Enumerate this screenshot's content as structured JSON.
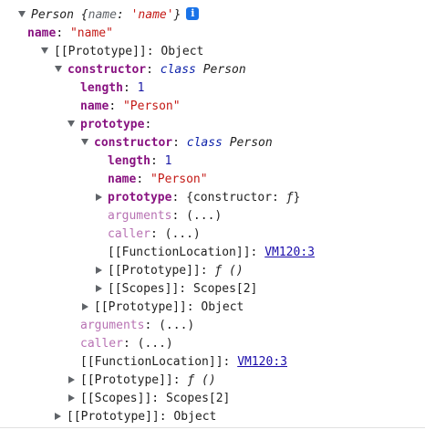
{
  "root": {
    "class_name": "Person",
    "preview_open": " {",
    "preview_key": "name",
    "preview_colon": ": ",
    "preview_value": "'name'",
    "preview_close": "}",
    "info_icon_glyph": "i"
  },
  "rows": {
    "r1": {
      "key": "name",
      "value": "\"name\""
    },
    "r2": {
      "key": "[[Prototype]]",
      "value": "Object"
    },
    "r3": {
      "key": "constructor",
      "kw": "class",
      "value": "Person"
    },
    "r4": {
      "key": "length",
      "value": "1"
    },
    "r5": {
      "key": "name",
      "value": "\"Person\""
    },
    "r6": {
      "key": "prototype",
      "value": ""
    },
    "r7": {
      "key": "constructor",
      "kw": "class",
      "value": "Person"
    },
    "r8": {
      "key": "length",
      "value": "1"
    },
    "r9": {
      "key": "name",
      "value": "\"Person\""
    },
    "r10": {
      "key": "prototype",
      "value": "{constructor: ",
      "fn": "ƒ",
      "close": "}"
    },
    "r11": {
      "key": "arguments",
      "value": "(...)"
    },
    "r12": {
      "key": "caller",
      "value": "(...)"
    },
    "r13": {
      "key": "[[FunctionLocation]]",
      "value": "VM120:3"
    },
    "r14": {
      "key": "[[Prototype]]",
      "value": "ƒ ()"
    },
    "r15": {
      "key": "[[Scopes]]",
      "value": "Scopes[2]"
    },
    "r16": {
      "key": "[[Prototype]]",
      "value": "Object"
    },
    "r17": {
      "key": "arguments",
      "value": "(...)"
    },
    "r18": {
      "key": "caller",
      "value": "(...)"
    },
    "r19": {
      "key": "[[FunctionLocation]]",
      "value": "VM120:3"
    },
    "r20": {
      "key": "[[Prototype]]",
      "value": "ƒ ()"
    },
    "r21": {
      "key": "[[Scopes]]",
      "value": "Scopes[2]"
    },
    "r22": {
      "key": "[[Prototype]]",
      "value": "Object"
    }
  },
  "colon": ": ",
  "icons": {
    "expanded": "triangle-down-icon",
    "collapsed": "triangle-right-icon",
    "info": "info-icon"
  },
  "colors": {
    "key": "#881280",
    "string": "#c41a16",
    "number": "#1a1aa6",
    "keyword": "#0d22aa",
    "link": "#1a0dab",
    "info": "#1a73e8"
  }
}
